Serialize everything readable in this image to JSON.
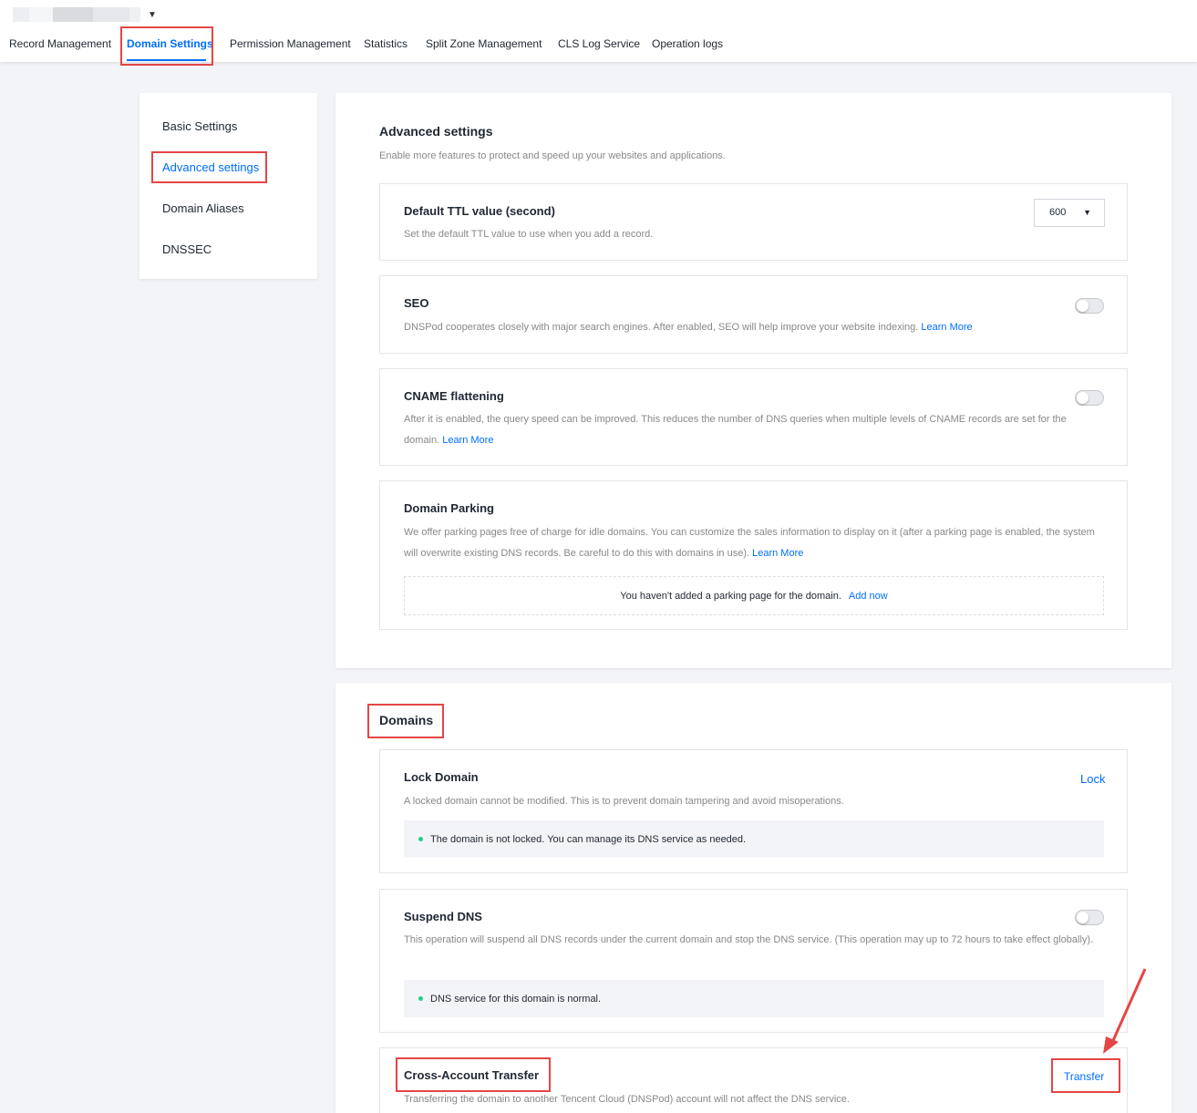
{
  "topbar": {
    "tabs": [
      {
        "label": "Record Management"
      },
      {
        "label": "Domain Settings"
      },
      {
        "label": "Permission Management"
      },
      {
        "label": "Statistics"
      },
      {
        "label": "Split Zone Management"
      },
      {
        "label": "CLS Log Service"
      },
      {
        "label": "Operation logs"
      }
    ]
  },
  "sidenav": {
    "items": [
      {
        "label": "Basic Settings"
      },
      {
        "label": "Advanced settings"
      },
      {
        "label": "Domain Aliases"
      },
      {
        "label": "DNSSEC"
      }
    ]
  },
  "advanced": {
    "title": "Advanced settings",
    "desc": "Enable more features to protect and speed up your websites and applications.",
    "ttl": {
      "title": "Default TTL value (second)",
      "desc": "Set the default TTL value to use when you add a record.",
      "value": "600"
    },
    "seo": {
      "title": "SEO",
      "desc": "DNSPod cooperates closely with major search engines. After enabled, SEO will help improve your website indexing.",
      "link": "Learn More"
    },
    "cname": {
      "title": "CNAME flattening",
      "desc": "After it is enabled, the query speed can be improved. This reduces the number of DNS queries when multiple levels of CNAME records are set for the domain.",
      "link": "Learn More"
    },
    "parking": {
      "title": "Domain Parking",
      "desc": "We offer parking pages free of charge for idle domains. You can customize the sales information to display on it (after a parking page is enabled, the system will overwrite existing DNS records. Be careful to do this with domains in use).",
      "link": "Learn More",
      "empty_text": "You haven't added a parking page for the domain.",
      "add_link": "Add now"
    }
  },
  "domains": {
    "title": "Domains",
    "lock": {
      "title": "Lock Domain",
      "desc": "A locked domain cannot be modified. This is to prevent domain tampering and avoid misoperations.",
      "action": "Lock",
      "status": "The domain is not locked. You can manage its DNS service as needed."
    },
    "suspend": {
      "title": "Suspend DNS",
      "desc": "This operation will suspend all DNS records under the current domain and stop the DNS service. (This operation may up to 72 hours to take effect globally).",
      "status": "DNS service for this domain is normal."
    },
    "transfer": {
      "title": "Cross-Account Transfer",
      "desc": "Transferring the domain to another Tencent Cloud (DNSPod) account will not affect the DNS service.",
      "action": "Transfer"
    }
  },
  "colors": {
    "accent": "#006eff",
    "highlight": "#e54545",
    "status_ok": "#29cc85"
  }
}
